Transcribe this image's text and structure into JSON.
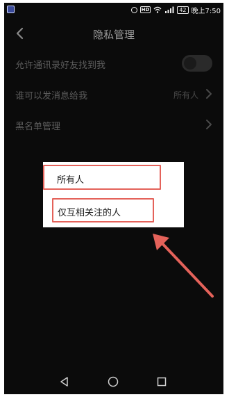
{
  "status_bar": {
    "hd_label": "HD",
    "battery": "42",
    "time": "晚上7:50"
  },
  "header": {
    "title": "隐私管理",
    "back_icon": "chevron-left-icon"
  },
  "settings": {
    "contacts_row": {
      "label": "允许通讯录好友找到我",
      "toggle_on": false
    },
    "message_row": {
      "label": "谁可以发消息给我",
      "value": "所有人"
    },
    "blacklist_row": {
      "label": "黑名单管理"
    }
  },
  "popup": {
    "options": [
      {
        "label": "所有人"
      },
      {
        "label": "仅互相关注的人"
      }
    ]
  },
  "annotation": {
    "color": "#e4625a"
  },
  "nav_bar": {
    "back_icon": "triangle-back-icon",
    "home_icon": "circle-home-icon",
    "recent_icon": "square-recent-icon"
  }
}
